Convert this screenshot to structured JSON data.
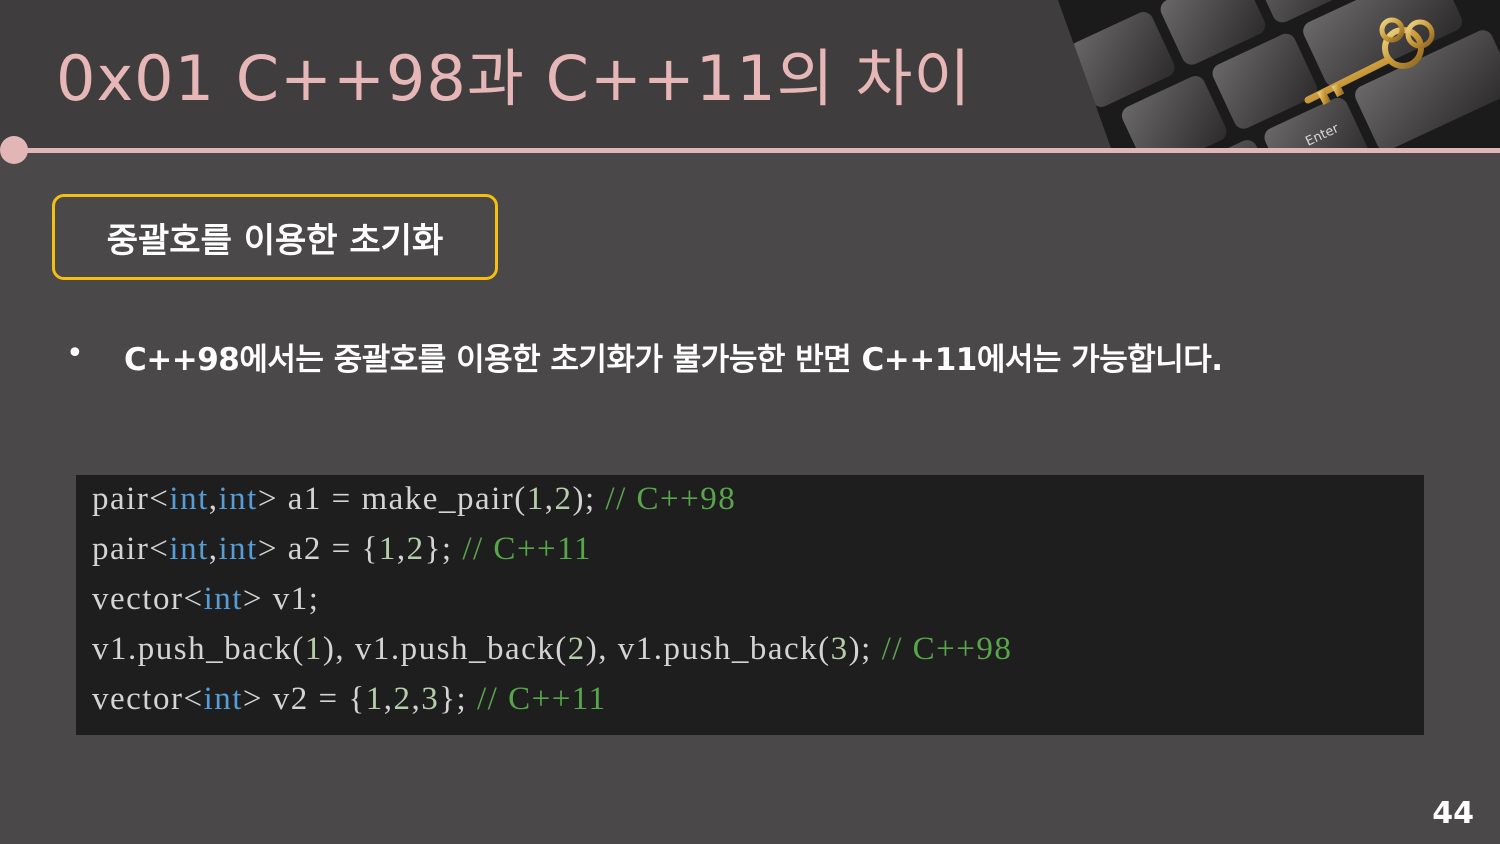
{
  "slide": {
    "title": "0x01  C++98과 C++11의 차이",
    "section_label": "중괄호를 이용한 초기화",
    "bullet_text": "C++98에서는 중괄호를 이용한 초기화가 불가능한 반면 C++11에서는 가능합니다.",
    "page_number": "44",
    "accent_color": "#e7b7b8",
    "box_border_color": "#f5be12"
  },
  "photo": {
    "key_label": "Enter",
    "icon": "key-on-keyboard-photo"
  },
  "code": {
    "lines": [
      [
        {
          "t": "pair<",
          "c": "plain"
        },
        {
          "t": "int",
          "c": "kw"
        },
        {
          "t": ",",
          "c": "plain"
        },
        {
          "t": "int",
          "c": "kw"
        },
        {
          "t": "> a1 = make_pair(",
          "c": "plain"
        },
        {
          "t": "1",
          "c": "num"
        },
        {
          "t": ",",
          "c": "plain"
        },
        {
          "t": "2",
          "c": "num"
        },
        {
          "t": "); ",
          "c": "plain"
        },
        {
          "t": "// C++98",
          "c": "cm"
        }
      ],
      [
        {
          "t": "pair<",
          "c": "plain"
        },
        {
          "t": "int",
          "c": "kw"
        },
        {
          "t": ",",
          "c": "plain"
        },
        {
          "t": "int",
          "c": "kw"
        },
        {
          "t": "> a2 = {",
          "c": "plain"
        },
        {
          "t": "1",
          "c": "num"
        },
        {
          "t": ",",
          "c": "plain"
        },
        {
          "t": "2",
          "c": "num"
        },
        {
          "t": "}; ",
          "c": "plain"
        },
        {
          "t": "// C++11",
          "c": "cm"
        }
      ],
      [
        {
          "t": "vector<",
          "c": "plain"
        },
        {
          "t": "int",
          "c": "kw"
        },
        {
          "t": "> v1;",
          "c": "plain"
        }
      ],
      [
        {
          "t": "v1.push_back(",
          "c": "plain"
        },
        {
          "t": "1",
          "c": "num"
        },
        {
          "t": "), v1.push_back(",
          "c": "plain"
        },
        {
          "t": "2",
          "c": "num"
        },
        {
          "t": "), v1.push_back(",
          "c": "plain"
        },
        {
          "t": "3",
          "c": "num"
        },
        {
          "t": "); ",
          "c": "plain"
        },
        {
          "t": "// C++98",
          "c": "cm"
        }
      ],
      [
        {
          "t": "vector<",
          "c": "plain"
        },
        {
          "t": "int",
          "c": "kw"
        },
        {
          "t": "> v2 = {",
          "c": "plain"
        },
        {
          "t": "1",
          "c": "num"
        },
        {
          "t": ",",
          "c": "plain"
        },
        {
          "t": "2",
          "c": "num"
        },
        {
          "t": ",",
          "c": "plain"
        },
        {
          "t": "3",
          "c": "num"
        },
        {
          "t": "}; ",
          "c": "plain"
        },
        {
          "t": "// C++11",
          "c": "cm"
        }
      ]
    ]
  }
}
